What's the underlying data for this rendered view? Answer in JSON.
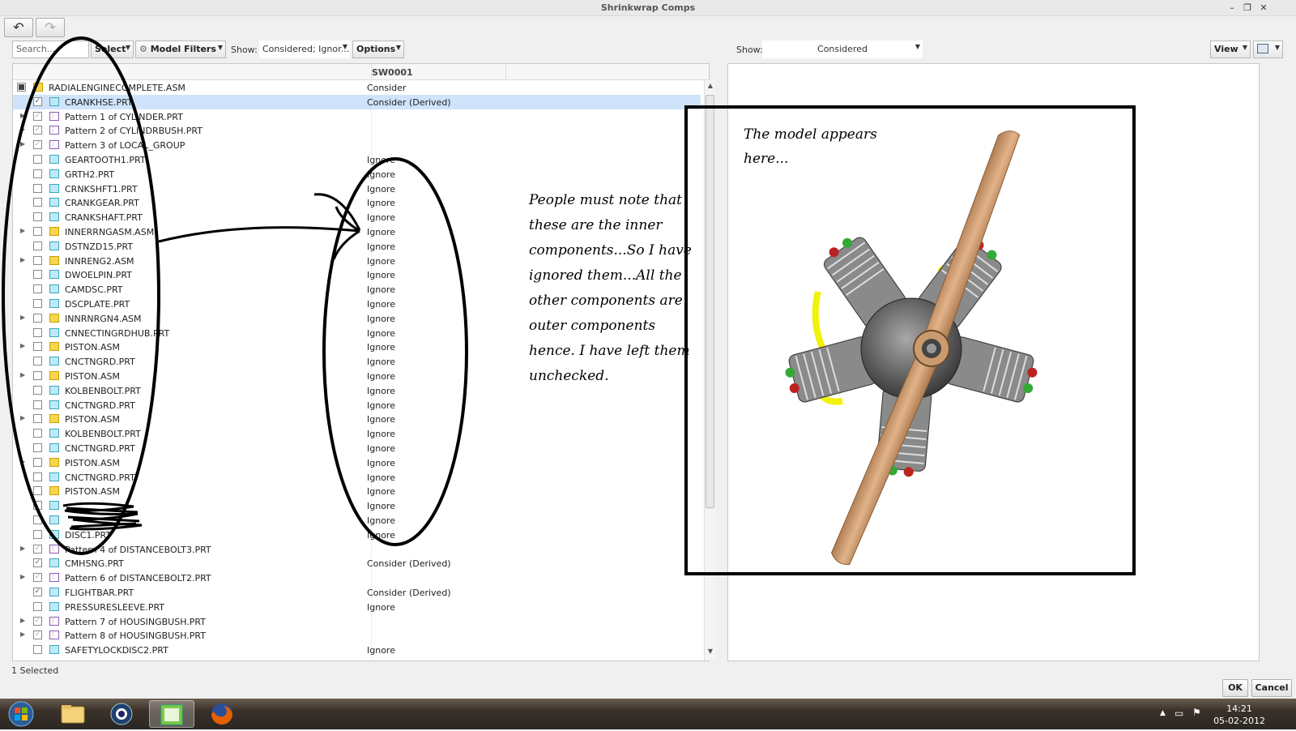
{
  "window": {
    "title": "Shrinkwrap Comps",
    "controls": [
      "–",
      "❐",
      "✕"
    ]
  },
  "toolbar": {
    "search_placeholder": "Search...",
    "select_label": "Select",
    "model_filters_label": "Model Filters",
    "show_label": "Show:",
    "show_value": "Considered; Ignor...",
    "options_label": "Options",
    "right_show_label": "Show:",
    "right_show_value": "Considered",
    "view_label": "View"
  },
  "tree": {
    "column_header": "SW0001",
    "rows": [
      {
        "name": "RADIALENGINECOMPLETE.ASM",
        "status": "Consider",
        "type": "asm",
        "check": "partial",
        "expand": false,
        "level": 0
      },
      {
        "name": "CRANKHSE.PRT",
        "status": "Consider (Derived)",
        "type": "prt",
        "check": "checked",
        "expand": false,
        "level": 1,
        "selected": true
      },
      {
        "name": "Pattern 1 of CYLINDER.PRT",
        "status": "",
        "type": "pat",
        "check": "checked-grey",
        "expand": true,
        "level": 1
      },
      {
        "name": "Pattern 2 of CYLINDRBUSH.PRT",
        "status": "",
        "type": "pat",
        "check": "checked-grey",
        "expand": true,
        "level": 1
      },
      {
        "name": "Pattern 3 of LOCAL_GROUP",
        "status": "",
        "type": "pat",
        "check": "checked-grey",
        "expand": true,
        "level": 1
      },
      {
        "name": "GEARTOOTH1.PRT",
        "status": "Ignore",
        "type": "prt",
        "check": "empty",
        "expand": false,
        "level": 1
      },
      {
        "name": "GRTH2.PRT",
        "status": "Ignore",
        "type": "prt",
        "check": "empty",
        "expand": false,
        "level": 1
      },
      {
        "name": "CRNKSHFT1.PRT",
        "status": "Ignore",
        "type": "prt",
        "check": "empty",
        "expand": false,
        "level": 1
      },
      {
        "name": "CRANKGEAR.PRT",
        "status": "Ignore",
        "type": "prt",
        "check": "empty",
        "expand": false,
        "level": 1
      },
      {
        "name": "CRANKSHAFT.PRT",
        "status": "Ignore",
        "type": "prt",
        "check": "empty",
        "expand": false,
        "level": 1
      },
      {
        "name": "INNERRNGASM.ASM",
        "status": "Ignore",
        "type": "asm",
        "check": "empty",
        "expand": true,
        "level": 1
      },
      {
        "name": "DSTNZD15.PRT",
        "status": "Ignore",
        "type": "prt",
        "check": "empty",
        "expand": false,
        "level": 1
      },
      {
        "name": "INNRENG2.ASM",
        "status": "Ignore",
        "type": "asm",
        "check": "empty",
        "expand": true,
        "level": 1
      },
      {
        "name": "DWOELPIN.PRT",
        "status": "Ignore",
        "type": "prt",
        "check": "empty",
        "expand": false,
        "level": 1
      },
      {
        "name": "CAMDSC.PRT",
        "status": "Ignore",
        "type": "prt",
        "check": "empty",
        "expand": false,
        "level": 1
      },
      {
        "name": "DSCPLATE.PRT",
        "status": "Ignore",
        "type": "prt",
        "check": "empty",
        "expand": false,
        "level": 1
      },
      {
        "name": "INNRNRGN4.ASM",
        "status": "Ignore",
        "type": "asm",
        "check": "empty",
        "expand": true,
        "level": 1
      },
      {
        "name": "CNNECTINGRDHUB.PRT",
        "status": "Ignore",
        "type": "prt",
        "check": "empty",
        "expand": false,
        "level": 1
      },
      {
        "name": "PISTON.ASM",
        "status": "Ignore",
        "type": "asm",
        "check": "empty",
        "expand": true,
        "level": 1
      },
      {
        "name": "CNCTNGRD.PRT",
        "status": "Ignore",
        "type": "prt",
        "check": "empty",
        "expand": false,
        "level": 1
      },
      {
        "name": "PISTON.ASM",
        "status": "Ignore",
        "type": "asm",
        "check": "empty",
        "expand": true,
        "level": 1
      },
      {
        "name": "KOLBENBOLT.PRT",
        "status": "Ignore",
        "type": "prt",
        "check": "empty",
        "expand": false,
        "level": 1
      },
      {
        "name": "CNCTNGRD.PRT",
        "status": "Ignore",
        "type": "prt",
        "check": "empty",
        "expand": false,
        "level": 1
      },
      {
        "name": "PISTON.ASM",
        "status": "Ignore",
        "type": "asm",
        "check": "empty",
        "expand": true,
        "level": 1
      },
      {
        "name": "KOLBENBOLT.PRT",
        "status": "Ignore",
        "type": "prt",
        "check": "empty",
        "expand": false,
        "level": 1
      },
      {
        "name": "CNCTNGRD.PRT",
        "status": "Ignore",
        "type": "prt",
        "check": "empty",
        "expand": false,
        "level": 1
      },
      {
        "name": "PISTON.ASM",
        "status": "Ignore",
        "type": "asm",
        "check": "empty",
        "expand": true,
        "level": 1
      },
      {
        "name": "CNCTNGRD.PRT",
        "status": "Ignore",
        "type": "prt",
        "check": "empty",
        "expand": false,
        "level": 1
      },
      {
        "name": "PISTON.ASM",
        "status": "Ignore",
        "type": "asm",
        "check": "empty",
        "expand": false,
        "level": 1
      },
      {
        "name": "",
        "status": "Ignore",
        "type": "prt",
        "check": "empty",
        "expand": false,
        "level": 1,
        "redacted": true
      },
      {
        "name": "",
        "status": "Ignore",
        "type": "prt",
        "check": "empty",
        "expand": false,
        "level": 1,
        "redacted": true
      },
      {
        "name": "DISC1.PRT",
        "status": "Ignore",
        "type": "prt",
        "check": "empty",
        "expand": false,
        "level": 1
      },
      {
        "name": "Pattern 4 of DISTANCEBOLT3.PRT",
        "status": "",
        "type": "pat",
        "check": "checked-grey",
        "expand": true,
        "level": 1
      },
      {
        "name": "CMHSNG.PRT",
        "status": "Consider (Derived)",
        "type": "prt",
        "check": "checked",
        "expand": false,
        "level": 1
      },
      {
        "name": "Pattern 6 of DISTANCEBOLT2.PRT",
        "status": "",
        "type": "pat",
        "check": "checked-grey",
        "expand": true,
        "level": 1
      },
      {
        "name": "FLIGHTBAR.PRT",
        "status": "Consider (Derived)",
        "type": "prt",
        "check": "checked",
        "expand": false,
        "level": 1
      },
      {
        "name": "PRESSURESLEEVE.PRT",
        "status": "Ignore",
        "type": "prt",
        "check": "empty",
        "expand": false,
        "level": 1
      },
      {
        "name": "Pattern 7 of HOUSINGBUSH.PRT",
        "status": "",
        "type": "pat",
        "check": "checked-grey",
        "expand": true,
        "level": 1
      },
      {
        "name": "Pattern 8 of HOUSINGBUSH.PRT",
        "status": "",
        "type": "pat",
        "check": "checked-grey",
        "expand": true,
        "level": 1
      },
      {
        "name": "SAFETYLOCKDISC2.PRT",
        "status": "Ignore",
        "type": "prt",
        "check": "empty",
        "expand": false,
        "level": 1
      }
    ]
  },
  "status_bar": {
    "selected_text": "1 Selected"
  },
  "dialog_buttons": {
    "ok": "OK",
    "cancel": "Cancel"
  },
  "annotations": {
    "model_note": [
      "The model appears",
      "here..."
    ],
    "explanation": [
      "People must note that",
      "these are the inner",
      "components...So I have",
      "ignored them...All the",
      "other components are",
      "outer components",
      "hence. I have left them",
      "unchecked."
    ]
  },
  "taskbar": {
    "time": "14:21",
    "date": "05-02-2012",
    "apps": [
      "start-button",
      "explorer",
      "media",
      "creo",
      "firefox"
    ]
  },
  "colors": {
    "propeller": "#c8956b",
    "engine_yellow": "#f1f10a",
    "engine_grey": "#6f6f6f"
  }
}
